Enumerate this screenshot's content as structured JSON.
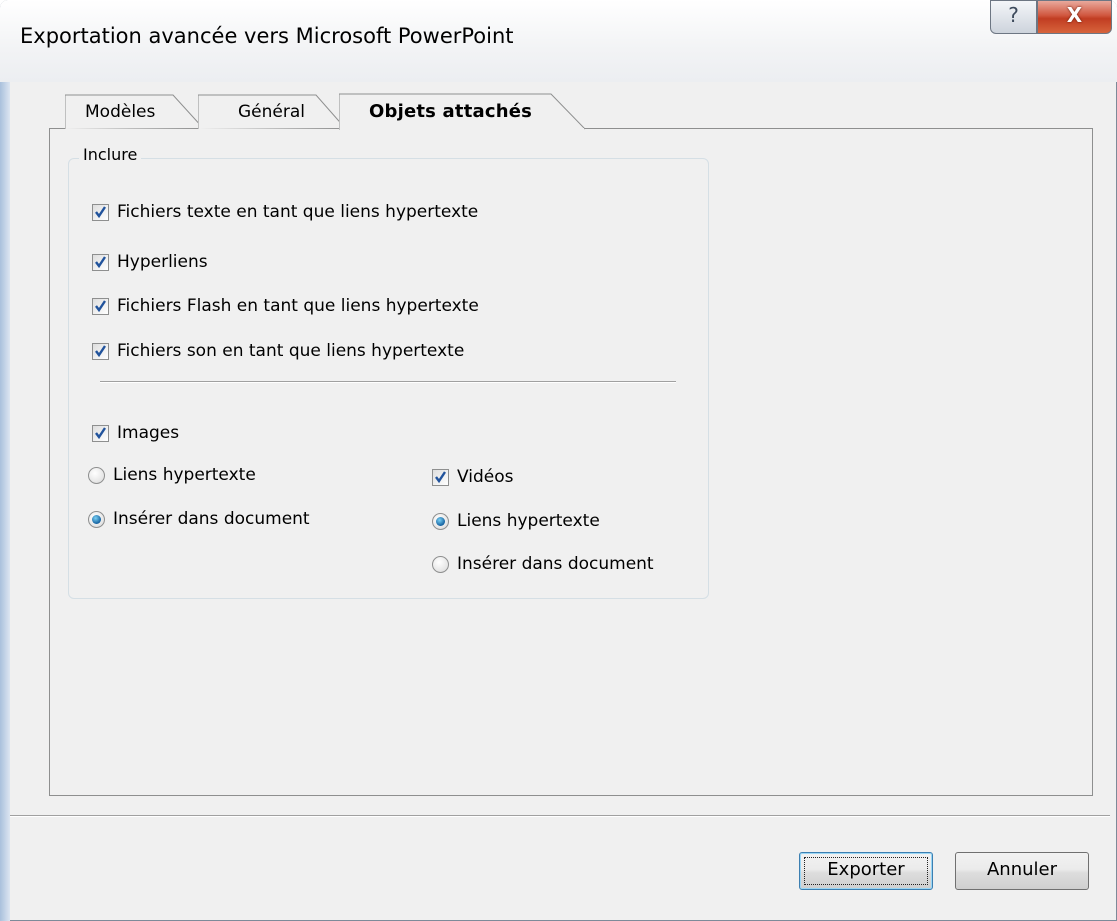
{
  "window": {
    "title": "Exportation avancée vers Microsoft PowerPoint",
    "help_glyph": "?",
    "close_glyph": "X"
  },
  "tabs": [
    {
      "label": "Modèles",
      "selected": false
    },
    {
      "label": "Général",
      "selected": false
    },
    {
      "label": "Objets attachés",
      "selected": true
    }
  ],
  "group": {
    "legend": "Inclure",
    "options": [
      {
        "label": "Fichiers texte en tant que liens hypertexte",
        "checked": true
      },
      {
        "label": "Hyperliens",
        "checked": true
      },
      {
        "label": "Fichiers Flash en tant que liens hypertexte",
        "checked": true
      },
      {
        "label": "Fichiers son en tant que liens hypertexte",
        "checked": true
      }
    ],
    "images": {
      "label": "Images",
      "checked": true,
      "radios": [
        {
          "label": "Liens hypertexte",
          "selected": false
        },
        {
          "label": "Insérer dans document",
          "selected": true
        }
      ]
    },
    "videos": {
      "label": "Vidéos",
      "checked": true,
      "radios": [
        {
          "label": "Liens hypertexte",
          "selected": true
        },
        {
          "label": "Insérer dans document",
          "selected": false
        }
      ]
    }
  },
  "buttons": {
    "export": "Exporter",
    "cancel": "Annuler"
  }
}
